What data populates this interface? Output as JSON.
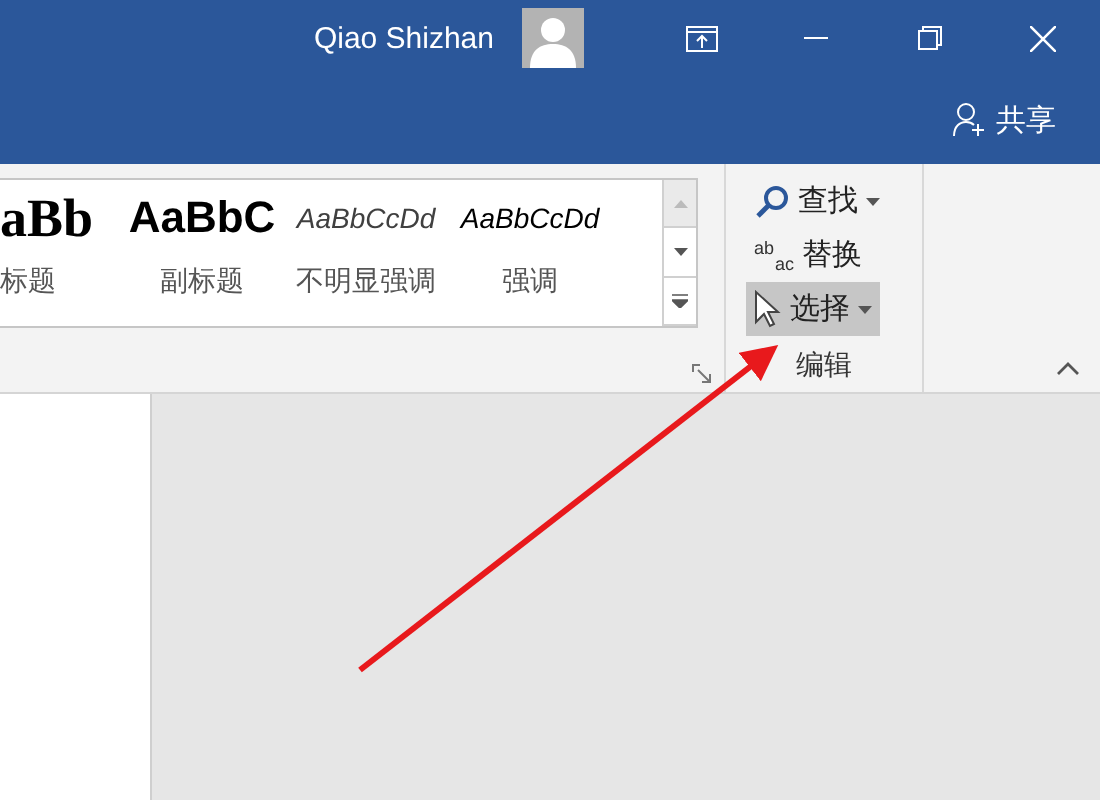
{
  "title_bar": {
    "user_name": "Qiao Shizhan",
    "share": "共享"
  },
  "style_gallery": [
    {
      "preview": "aBb",
      "label": "标题",
      "kind": "title"
    },
    {
      "preview": "AaBbC",
      "label": "副标题",
      "kind": "subtitle"
    },
    {
      "preview": "AaBbCcDd",
      "label": "不明显强调",
      "kind": "subtle-emphasis"
    },
    {
      "preview": "AaBbCcDd",
      "label": "强调",
      "kind": "emphasis"
    }
  ],
  "editing_group": {
    "label": "编辑",
    "items": [
      {
        "label": "查找",
        "kind": "find",
        "dropdown": true,
        "selected": false
      },
      {
        "label": "替换",
        "kind": "replace",
        "dropdown": false,
        "selected": false,
        "icon_top": "ab",
        "icon_bottom": "ac"
      },
      {
        "label": "选择",
        "kind": "select",
        "dropdown": true,
        "selected": true
      }
    ]
  }
}
